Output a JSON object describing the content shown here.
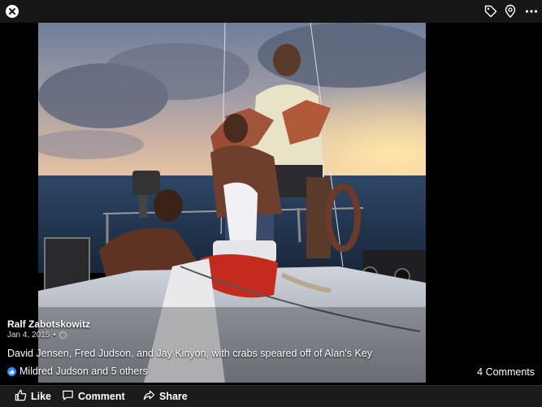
{
  "post": {
    "author": "Ralf Zabotskowitz",
    "date": "Jan 4, 2015",
    "date_separator": "•",
    "caption": "David Jensen, Fred Judson, and Jay Kinyon, with crabs speared off of Alan's Key",
    "reactions_text": "Mildred Judson and 5 others",
    "comments_text": "4 Comments"
  },
  "actions": {
    "like": "Like",
    "comment": "Comment",
    "share": "Share"
  },
  "icons": {
    "close": "close-icon",
    "tag": "tag-icon",
    "location": "location-pin-icon",
    "more": "more-icon",
    "privacy": "globe-icon",
    "reaction": "like-reaction-icon"
  },
  "colors": {
    "accent": "#2d88ff",
    "bar": "#1b1b1b"
  }
}
